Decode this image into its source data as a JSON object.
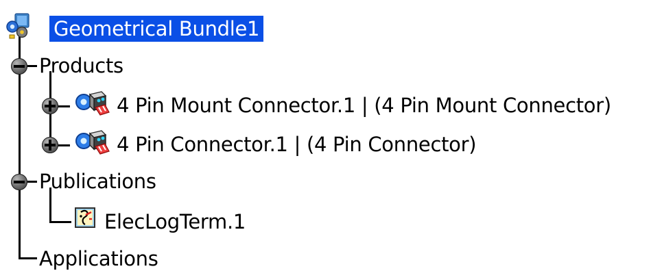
{
  "tree": {
    "root": {
      "label": "Geometrical Bundle1",
      "icon": "geometrical-bundle-icon",
      "selected": true
    },
    "products": {
      "label": "Products",
      "expanded": true,
      "items": [
        {
          "label": "4 Pin Mount Connector.1 | (4 Pin Mount Connector)",
          "icon": "product-connector-icon",
          "expanded": false
        },
        {
          "label": "4 Pin Connector.1 | (4 Pin Connector)",
          "icon": "product-connector-icon",
          "expanded": false
        }
      ]
    },
    "publications": {
      "label": "Publications",
      "expanded": true,
      "items": [
        {
          "label": "ElecLogTerm.1",
          "icon": "publication-icon"
        }
      ]
    },
    "applications": {
      "label": "Applications"
    }
  },
  "colors": {
    "selection_background": "#0a4fe6",
    "selection_text": "#ffffff",
    "tree_line": "#000000"
  }
}
